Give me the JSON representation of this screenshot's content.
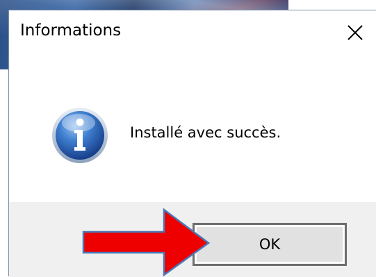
{
  "dialog": {
    "title": "Informations",
    "message": "Installé avec succès.",
    "ok_label": "OK"
  },
  "icons": {
    "close": "close-icon",
    "info": "info-icon",
    "annotation": "red-arrow-icon"
  },
  "colors": {
    "annotation_arrow": "#ee0000",
    "footer_bg": "#f0f0f0",
    "button_border": "#6d6d6d",
    "info_icon_blue": "#2f6fc4"
  }
}
